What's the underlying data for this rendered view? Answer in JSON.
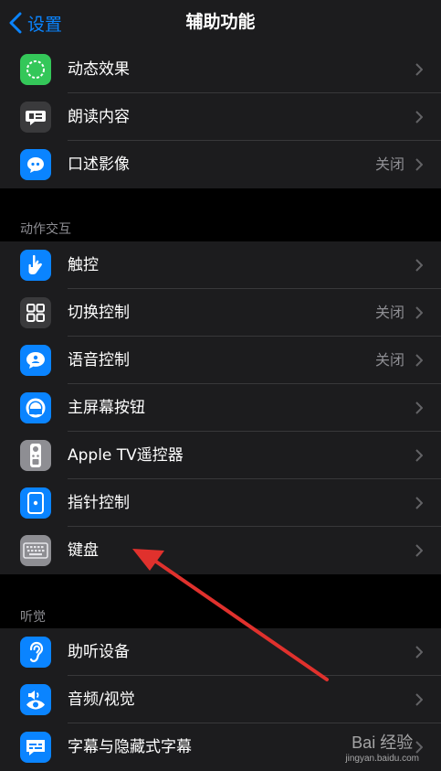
{
  "navbar": {
    "back_label": "设置",
    "title": "辅助功能"
  },
  "vision_group": {
    "items": [
      {
        "label": "动态效果",
        "value": "",
        "icon": "motion-icon"
      },
      {
        "label": "朗读内容",
        "value": "",
        "icon": "spoken-content-icon"
      },
      {
        "label": "口述影像",
        "value": "关闭",
        "icon": "audio-description-icon"
      }
    ]
  },
  "interaction_group": {
    "header": "动作交互",
    "items": [
      {
        "label": "触控",
        "value": "",
        "icon": "touch-hand-icon"
      },
      {
        "label": "切换控制",
        "value": "关闭",
        "icon": "switch-control-icon"
      },
      {
        "label": "语音控制",
        "value": "关闭",
        "icon": "voice-control-icon"
      },
      {
        "label": "主屏幕按钮",
        "value": "",
        "icon": "home-button-icon"
      },
      {
        "label": "Apple TV遥控器",
        "value": "",
        "icon": "tv-remote-icon"
      },
      {
        "label": "指针控制",
        "value": "",
        "icon": "pointer-control-icon"
      },
      {
        "label": "键盘",
        "value": "",
        "icon": "keyboard-icon"
      }
    ]
  },
  "hearing_group": {
    "header": "听觉",
    "items": [
      {
        "label": "助听设备",
        "value": "",
        "icon": "ear-icon"
      },
      {
        "label": "音频/视觉",
        "value": "",
        "icon": "audio-visual-icon"
      },
      {
        "label": "字幕与隐藏式字幕",
        "value": "",
        "icon": "subtitles-icon"
      }
    ]
  },
  "watermark": {
    "text": "Bai 经验",
    "url": "jingyan.baidu.com"
  },
  "colors": {
    "accent": "#0a84ff",
    "cell_bg": "#1c1c1e",
    "arrow": "#e0312d",
    "green": "#34c759",
    "blue": "#0a84ff",
    "gray": "#3a3a3c"
  }
}
